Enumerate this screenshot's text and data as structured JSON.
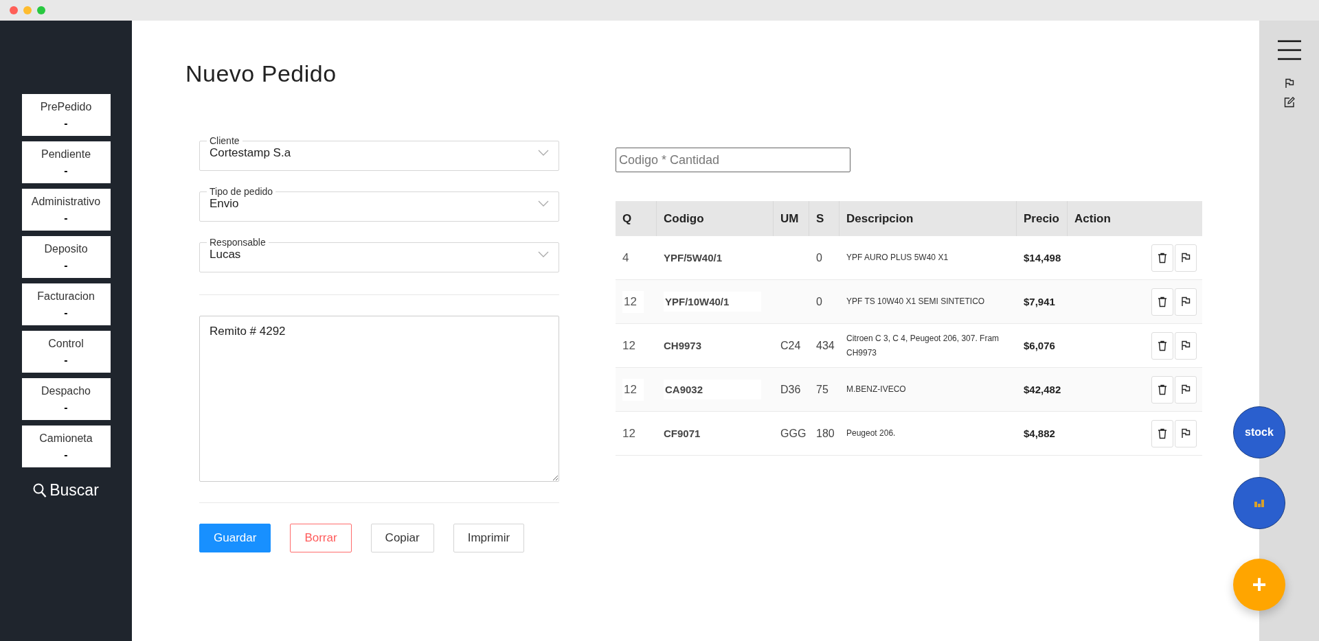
{
  "sidebar": {
    "items": [
      {
        "label": "PrePedido",
        "count": "-"
      },
      {
        "label": "Pendiente",
        "count": "-"
      },
      {
        "label": "Administrativo",
        "count": "-"
      },
      {
        "label": "Deposito",
        "count": "-"
      },
      {
        "label": "Facturacion",
        "count": "-"
      },
      {
        "label": "Control",
        "count": "-"
      },
      {
        "label": "Despacho",
        "count": "-"
      },
      {
        "label": "Camioneta",
        "count": "-"
      }
    ],
    "search_link": "Buscar"
  },
  "title": "Nuevo Pedido",
  "form": {
    "selects": [
      {
        "label": "Cliente",
        "value": "Cortestamp S.a"
      },
      {
        "label": "Tipo de pedido",
        "value": "Envio"
      },
      {
        "label": "Responsable",
        "value": "Lucas"
      }
    ],
    "notes": "Remito # 4292",
    "buttons": [
      {
        "label": "Guardar",
        "kind": "primary"
      },
      {
        "label": "Borrar",
        "kind": "danger"
      },
      {
        "label": "Copiar",
        "kind": "default"
      },
      {
        "label": "Imprimir",
        "kind": "default"
      }
    ]
  },
  "code_input": {
    "placeholder": "Codigo * Cantidad"
  },
  "table": {
    "columns": [
      "Q",
      "Codigo",
      "UM",
      "S",
      "Descripcion",
      "Precio",
      "Action"
    ],
    "rows": [
      {
        "q": "4",
        "codigo": "YPF/5W40/1",
        "um": "",
        "s": "0",
        "descripcion": "YPF AURO PLUS 5W40 X1",
        "precio": "$14,498",
        "editing": false
      },
      {
        "q": "12",
        "codigo": "YPF/10W40/1",
        "um": "",
        "s": "0",
        "descripcion": "YPF TS 10W40 X1 SEMI SINTETICO",
        "precio": "$7,941",
        "editing": true
      },
      {
        "q": "12",
        "codigo": "CH9973",
        "um": "C24",
        "s": "434",
        "descripcion": "Citroen C 3, C 4, Peugeot 206, 307. Fram CH9973",
        "precio": "$6,076",
        "editing": false
      },
      {
        "q": "12",
        "codigo": "CA9032",
        "um": "D36",
        "s": "75",
        "descripcion": "M.BENZ-IVECO",
        "precio": "$42,482",
        "editing": true
      },
      {
        "q": "12",
        "codigo": "CF9071",
        "um": "GGG",
        "s": "180",
        "descripcion": "Peugeot 206.",
        "precio": "$4,882",
        "editing": false
      }
    ]
  },
  "fabs": {
    "stock": "stock",
    "add": "+"
  }
}
